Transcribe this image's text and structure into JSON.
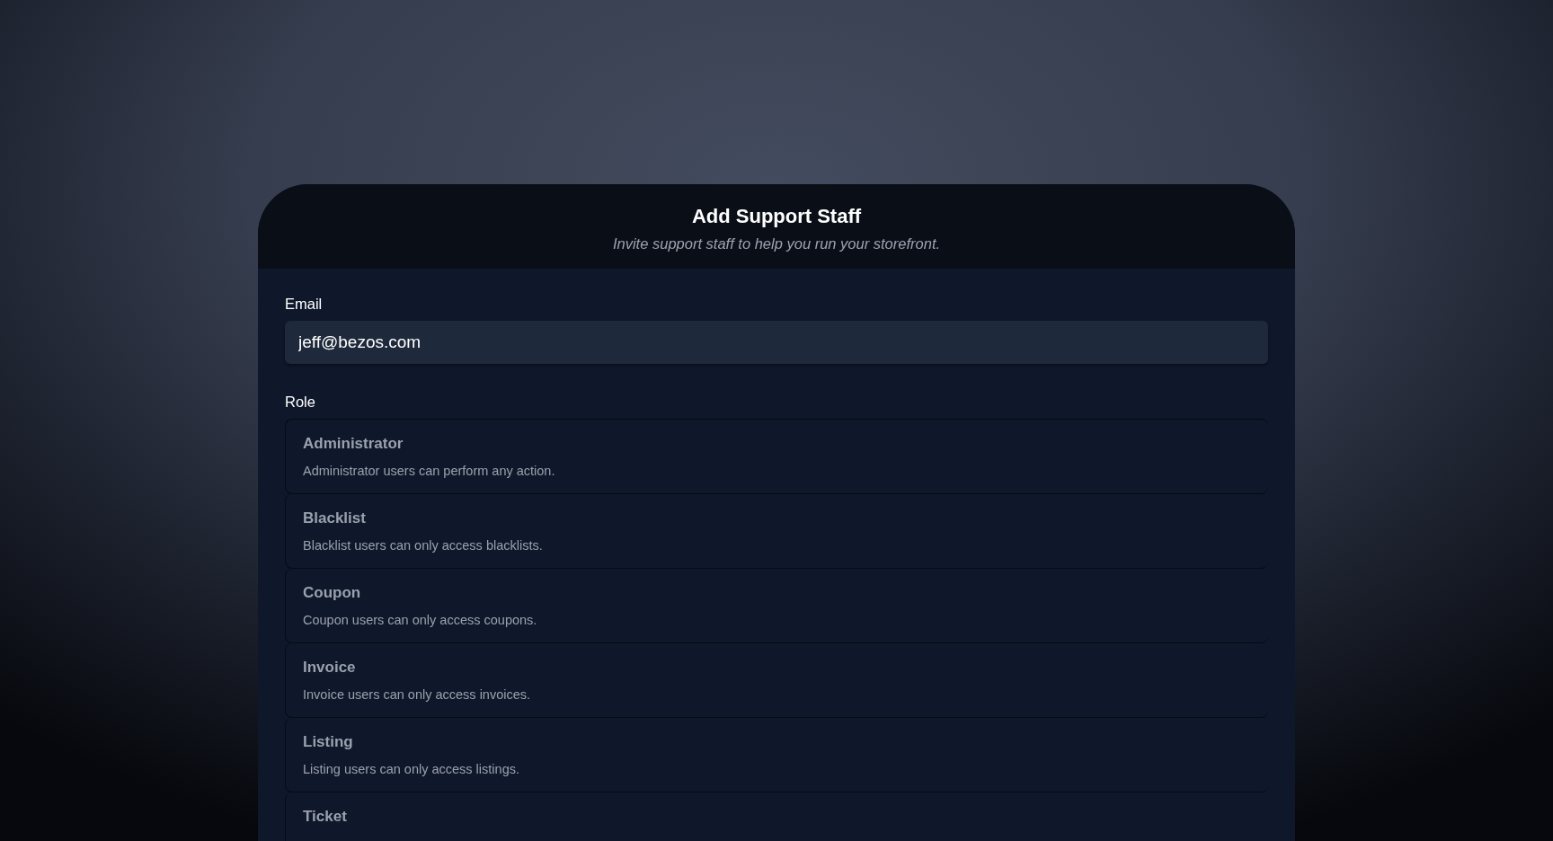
{
  "dialog": {
    "title": "Add Support Staff",
    "subtitle": "Invite support staff to help you run your storefront."
  },
  "email": {
    "label": "Email",
    "value": "jeff@bezos.com"
  },
  "role": {
    "label": "Role",
    "options": [
      {
        "name": "Administrator",
        "description": "Administrator users can perform any action."
      },
      {
        "name": "Blacklist",
        "description": "Blacklist users can only access blacklists."
      },
      {
        "name": "Coupon",
        "description": "Coupon users can only access coupons."
      },
      {
        "name": "Invoice",
        "description": "Invoice users can only access invoices."
      },
      {
        "name": "Listing",
        "description": "Listing users can only access listings."
      },
      {
        "name": "Ticket"
      }
    ]
  }
}
